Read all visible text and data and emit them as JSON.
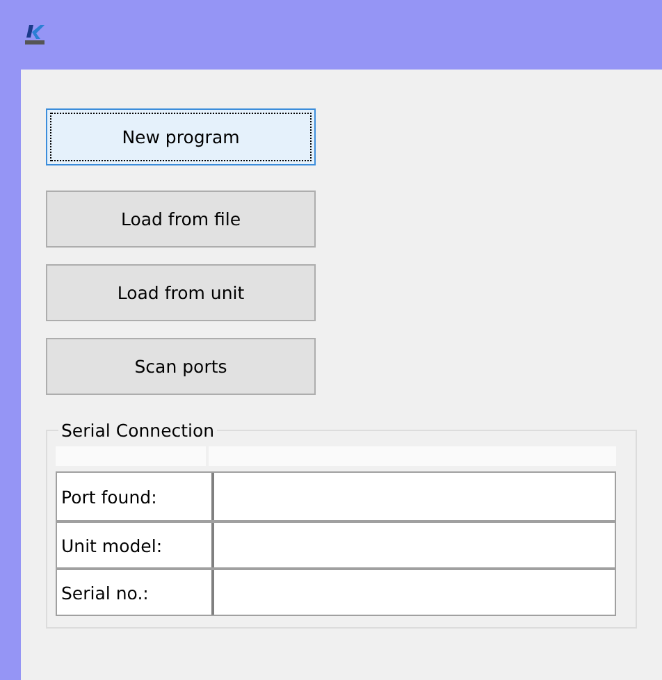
{
  "buttons": [
    {
      "label": "New program",
      "focused": true
    },
    {
      "label": "Load from file",
      "focused": false
    },
    {
      "label": "Load from unit",
      "focused": false
    },
    {
      "label": "Scan ports",
      "focused": false
    }
  ],
  "serial_connection": {
    "title": "Serial Connection",
    "rows": [
      {
        "label": "Port found:"
      },
      {
        "label": "Unit model:"
      },
      {
        "label": "Serial no.:"
      }
    ]
  }
}
